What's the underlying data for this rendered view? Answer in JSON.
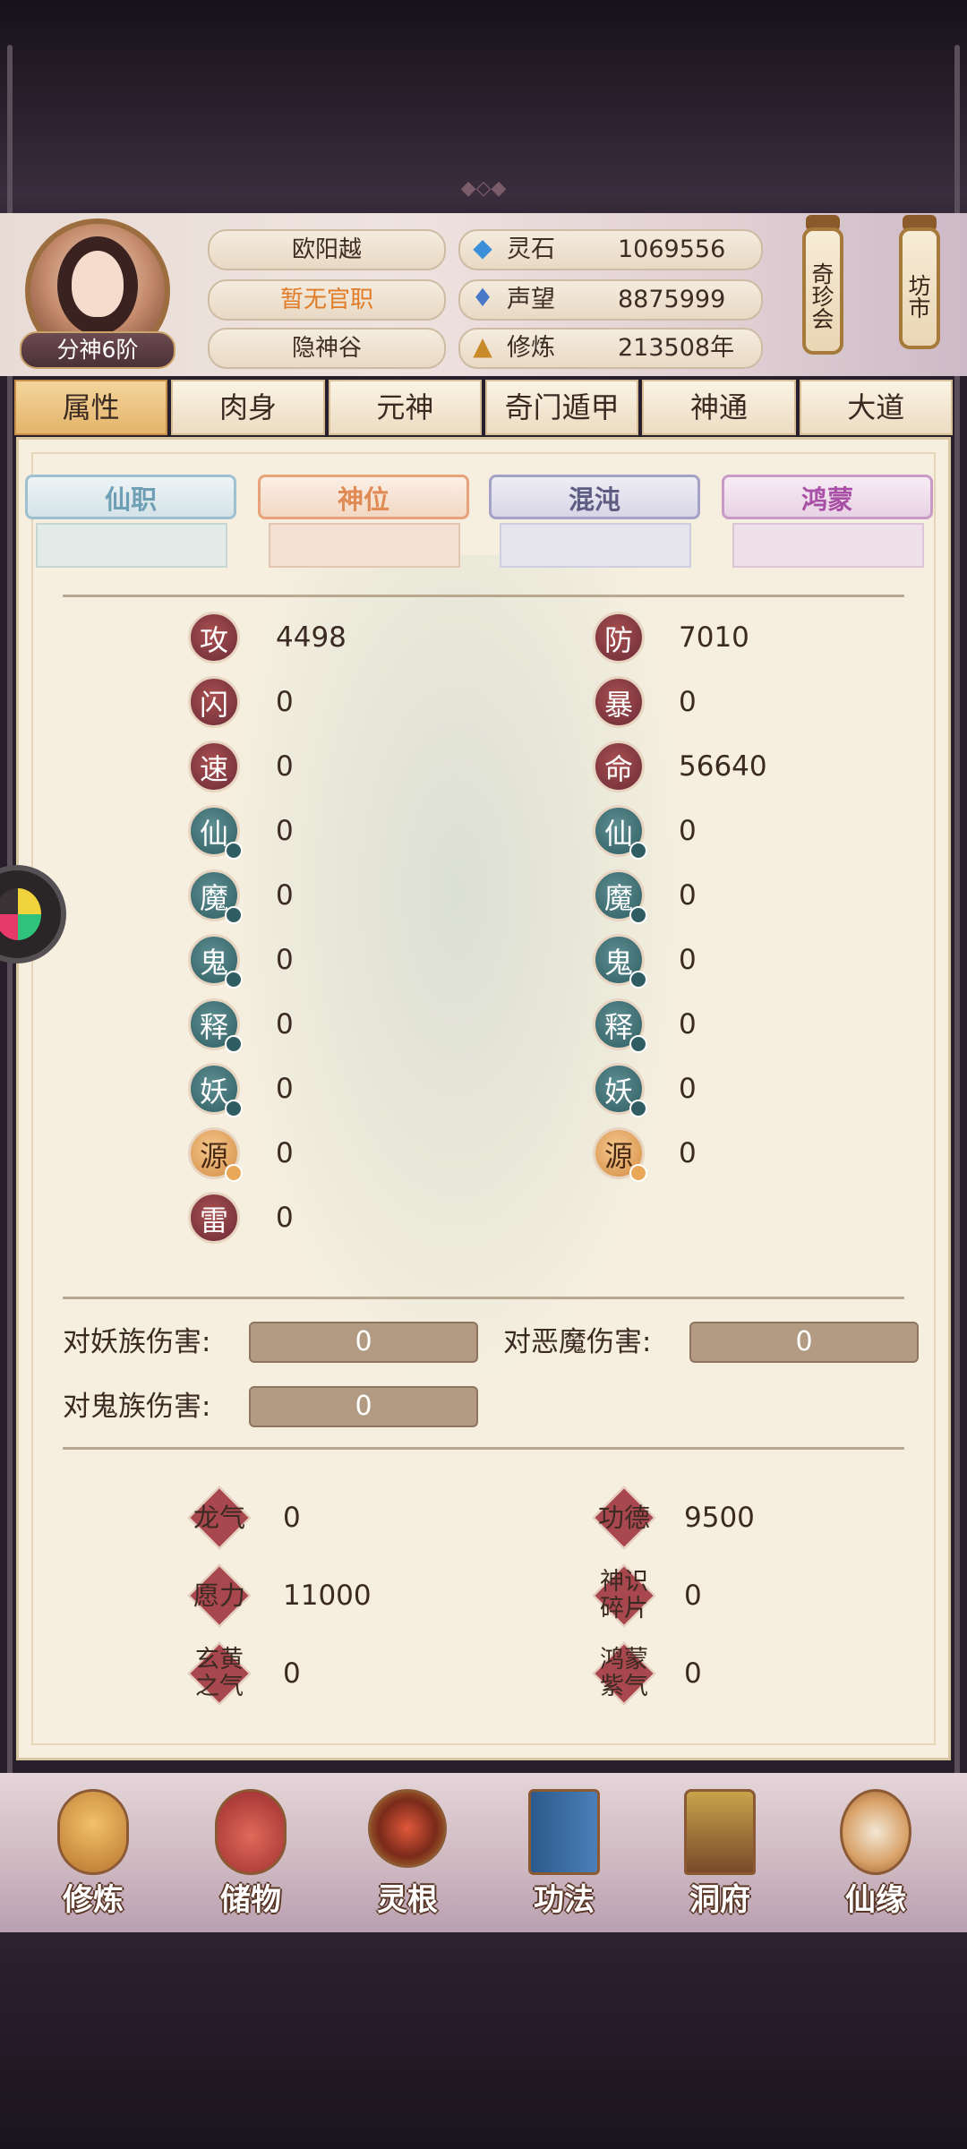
{
  "player": {
    "rank": "分神6阶",
    "name": "欧阳越",
    "title": "暂无官职",
    "sect": "隐神谷"
  },
  "resources": [
    {
      "icon": "spirit-stone-icon",
      "label": "灵石",
      "value": "1069556"
    },
    {
      "icon": "reputation-icon",
      "label": "声望",
      "value": "8875999"
    },
    {
      "icon": "cultivation-icon",
      "label": "修炼",
      "value": "213508年"
    }
  ],
  "hanging_buttons": [
    "奇珍会",
    "坊市"
  ],
  "main_tabs": [
    "属性",
    "肉身",
    "元神",
    "奇门遁甲",
    "神通",
    "大道"
  ],
  "sub_tabs": [
    "仙职",
    "神位",
    "混沌",
    "鸿蒙"
  ],
  "stats_left": [
    {
      "label": "攻",
      "value": "4498",
      "style": "red"
    },
    {
      "label": "闪",
      "value": "0",
      "style": "red"
    },
    {
      "label": "速",
      "value": "0",
      "style": "red"
    },
    {
      "label": "仙",
      "value": "0",
      "style": "teal"
    },
    {
      "label": "魔",
      "value": "0",
      "style": "teal"
    },
    {
      "label": "鬼",
      "value": "0",
      "style": "teal"
    },
    {
      "label": "释",
      "value": "0",
      "style": "teal"
    },
    {
      "label": "妖",
      "value": "0",
      "style": "teal"
    },
    {
      "label": "源",
      "value": "0",
      "style": "orange"
    },
    {
      "label": "雷",
      "value": "0",
      "style": "red"
    }
  ],
  "stats_right": [
    {
      "label": "防",
      "value": "7010",
      "style": "red"
    },
    {
      "label": "暴",
      "value": "0",
      "style": "red"
    },
    {
      "label": "命",
      "value": "56640",
      "style": "red"
    },
    {
      "label": "仙",
      "value": "0",
      "style": "teal"
    },
    {
      "label": "魔",
      "value": "0",
      "style": "teal"
    },
    {
      "label": "鬼",
      "value": "0",
      "style": "teal"
    },
    {
      "label": "释",
      "value": "0",
      "style": "teal"
    },
    {
      "label": "妖",
      "value": "0",
      "style": "teal"
    },
    {
      "label": "源",
      "value": "0",
      "style": "orange"
    }
  ],
  "damage": {
    "demon_race_label": "对妖族伤害:",
    "demon_race_value": "0",
    "evil_demon_label": "对恶魔伤害:",
    "evil_demon_value": "0",
    "ghost_race_label": "对鬼族伤害:",
    "ghost_race_value": "0"
  },
  "special_stats": [
    {
      "label": "龙气",
      "value": "0"
    },
    {
      "label": "功德",
      "value": "9500"
    },
    {
      "label": "愿力",
      "value": "11000"
    },
    {
      "label": "神识碎片",
      "value": "0"
    },
    {
      "label": "玄黄之气",
      "value": "0"
    },
    {
      "label": "鸿蒙紫气",
      "value": "0"
    }
  ],
  "bottom_nav": [
    "修炼",
    "储物",
    "灵根",
    "功法",
    "洞府",
    "仙缘"
  ],
  "colors": {
    "sub_tab_1": "#6f9fb5",
    "sub_tab_2": "#e08a55",
    "sub_tab_3": "#6a6890",
    "sub_tab_4": "#a84fa6"
  }
}
